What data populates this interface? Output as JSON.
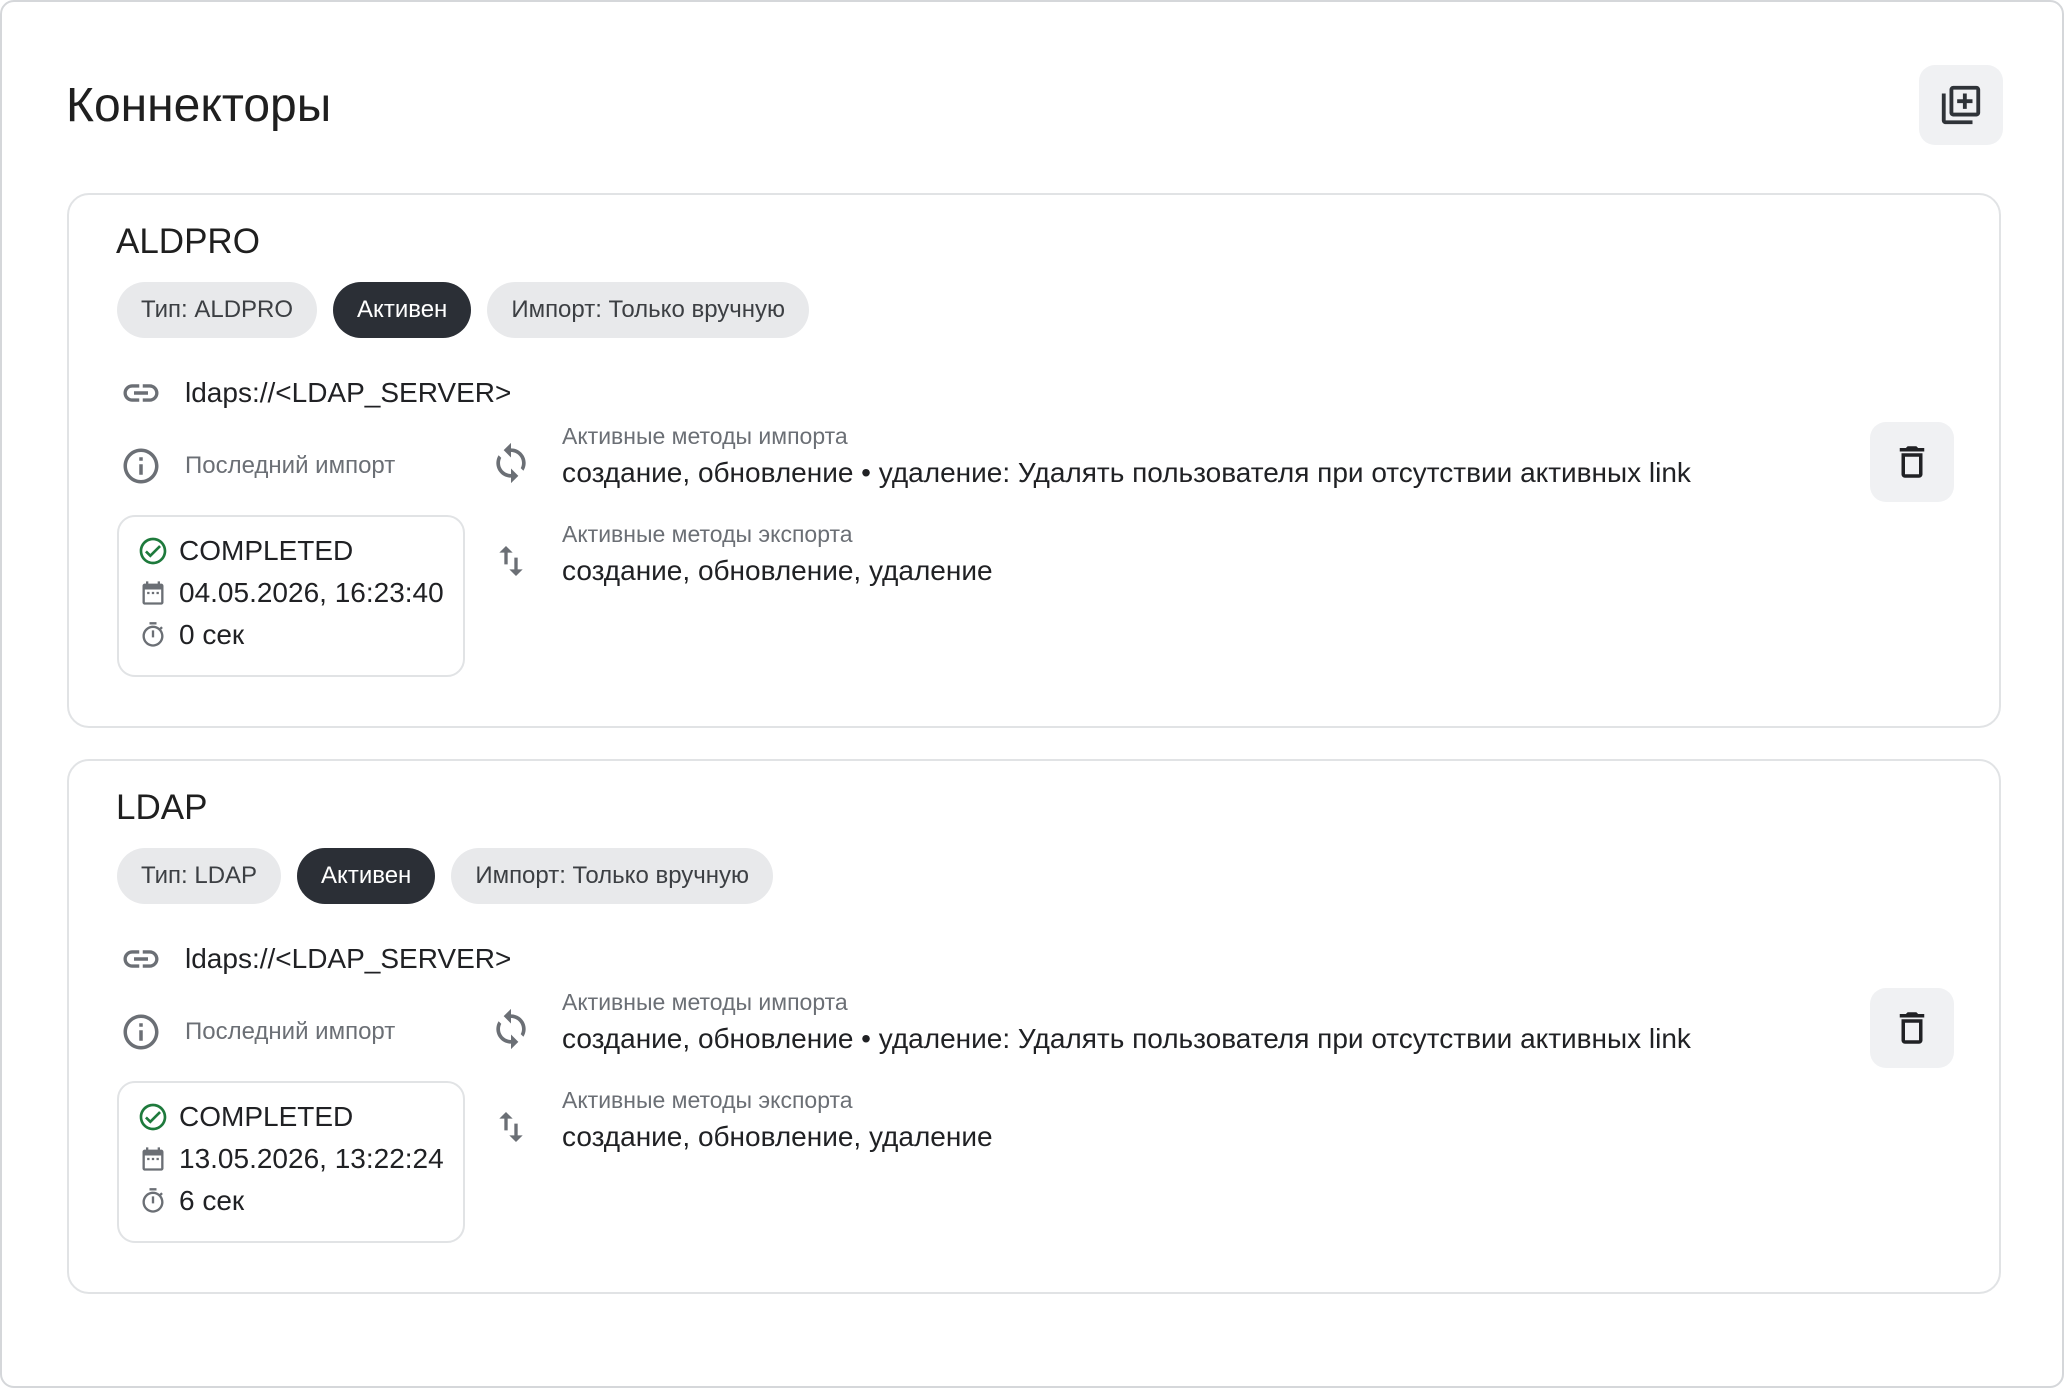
{
  "page": {
    "title": "Коннекторы",
    "add_button_icon": "add-box-multiple-icon"
  },
  "colors": {
    "active_chip_bg": "#2b2f36",
    "chip_bg": "#e8e9eb",
    "completed_green": "#1e7a3c"
  },
  "connectors": [
    {
      "name": "ALDPRO",
      "chips": {
        "type": "Тип: ALDPRO",
        "status": "Активен",
        "import_mode": "Импорт: Только вручную"
      },
      "url": "ldaps://<LDAP_SERVER>",
      "last_import": {
        "label": "Последний импорт",
        "status": "COMPLETED",
        "datetime": "04.05.2026, 16:23:40",
        "duration": "0 сек"
      },
      "import_methods": {
        "label": "Активные методы импорта",
        "value": "создание, обновление • удаление: Удалять пользователя при отсутствии активных link"
      },
      "export_methods": {
        "label": "Активные методы экспорта",
        "value": "создание, обновление, удаление"
      }
    },
    {
      "name": "LDAP",
      "chips": {
        "type": "Тип: LDAP",
        "status": "Активен",
        "import_mode": "Импорт: Только вручную"
      },
      "url": "ldaps://<LDAP_SERVER>",
      "last_import": {
        "label": "Последний импорт",
        "status": "COMPLETED",
        "datetime": "13.05.2026, 13:22:24",
        "duration": "6 сек"
      },
      "import_methods": {
        "label": "Активные методы импорта",
        "value": "создание, обновление • удаление: Удалять пользователя при отсутствии активных link"
      },
      "export_methods": {
        "label": "Активные методы экспорта",
        "value": "создание, обновление, удаление"
      }
    }
  ]
}
